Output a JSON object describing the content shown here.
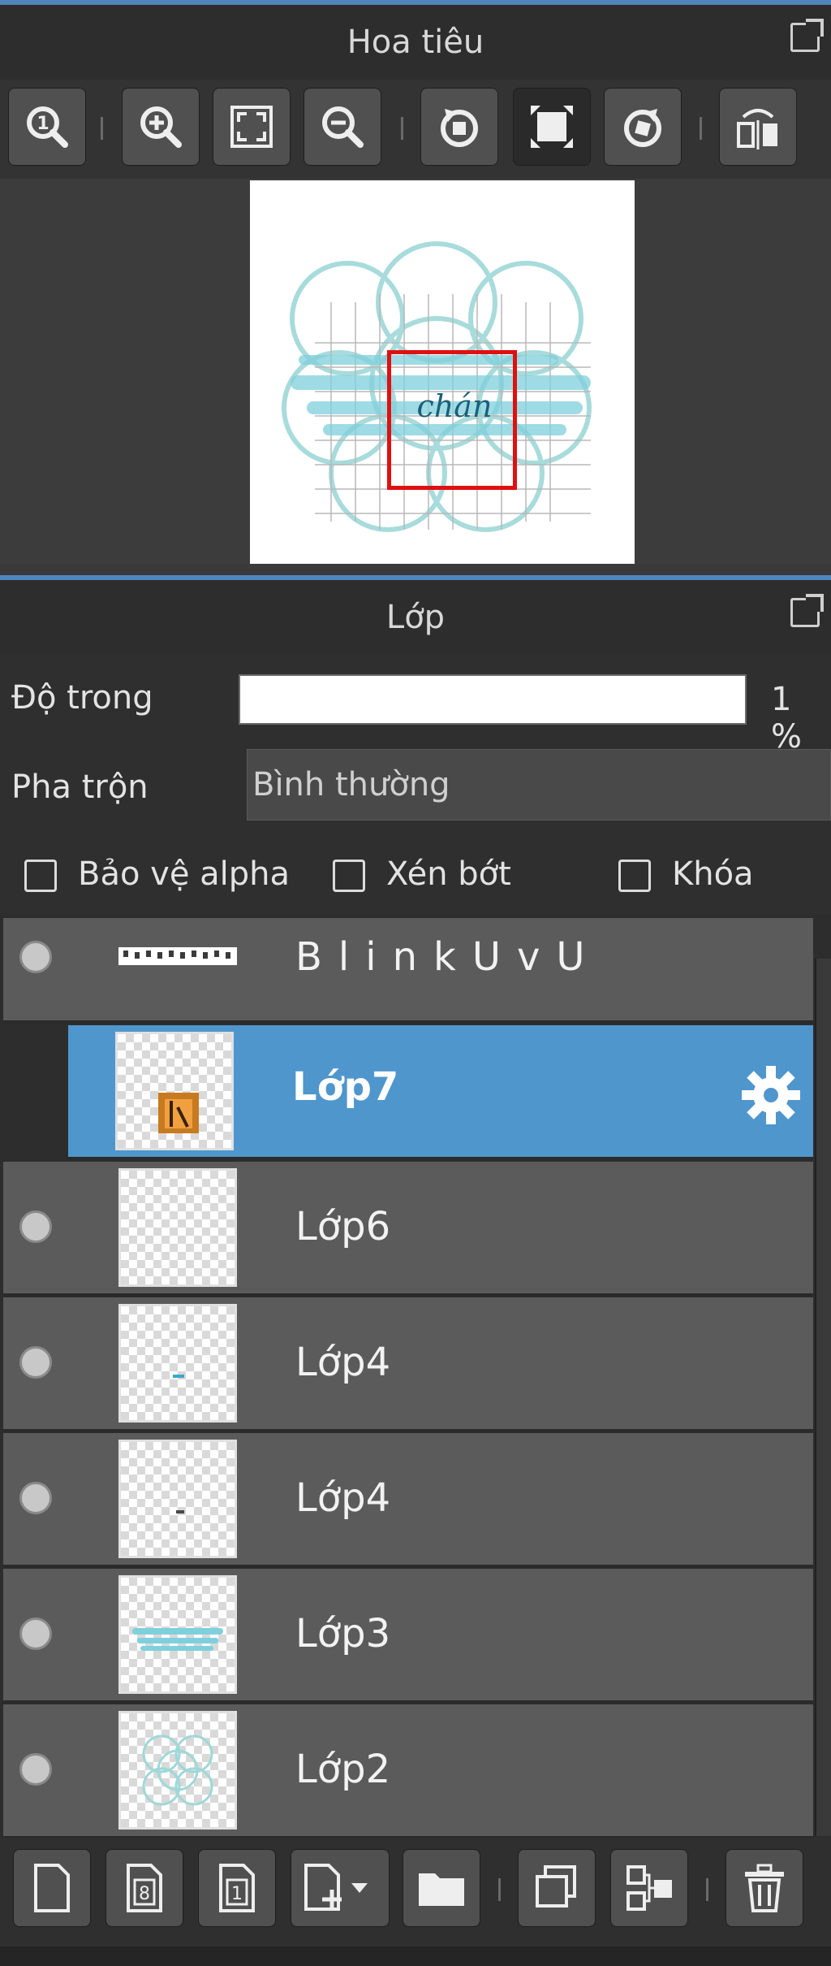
{
  "navigator": {
    "title": "Hoa tiêu",
    "canvas_text": "chán"
  },
  "layers_panel": {
    "title": "Lớp",
    "opacity_label": "Độ trong",
    "opacity_value": "1 %",
    "blend_label": "Pha trộn",
    "blend_value": "Bình thường",
    "checkboxes": [
      {
        "label": "Bảo vệ alpha",
        "checked": false
      },
      {
        "label": "Xén bớt",
        "checked": false
      },
      {
        "label": "Khóa",
        "checked": false
      }
    ],
    "layers": [
      {
        "name": "BlinkUvU",
        "selected": false
      },
      {
        "name": "Lớp7",
        "selected": true
      },
      {
        "name": "Lớp6",
        "selected": false
      },
      {
        "name": "Lớp4",
        "selected": false
      },
      {
        "name": "Lớp4",
        "selected": false
      },
      {
        "name": "Lớp3",
        "selected": false
      },
      {
        "name": "Lớp2",
        "selected": false
      }
    ]
  },
  "colors": {
    "accent": "#4f96cd",
    "panel_bg": "#2d2d2d",
    "row_bg": "#5b5b5b",
    "viewport_frame": "#e01010"
  },
  "icons": {
    "navigator_toolbar": [
      "zoom-actual-icon",
      "zoom-in-icon",
      "fit-screen-icon",
      "zoom-out-icon",
      "rotate-left-icon",
      "reset-view-icon",
      "rotate-right-icon",
      "flip-horizontal-icon"
    ],
    "layer_toolbar": [
      "new-layer-icon",
      "new-8bit-layer-icon",
      "new-1bit-layer-icon",
      "add-layer-dropdown-icon",
      "new-folder-icon",
      "duplicate-layer-icon",
      "merge-down-icon",
      "delete-layer-icon"
    ]
  }
}
